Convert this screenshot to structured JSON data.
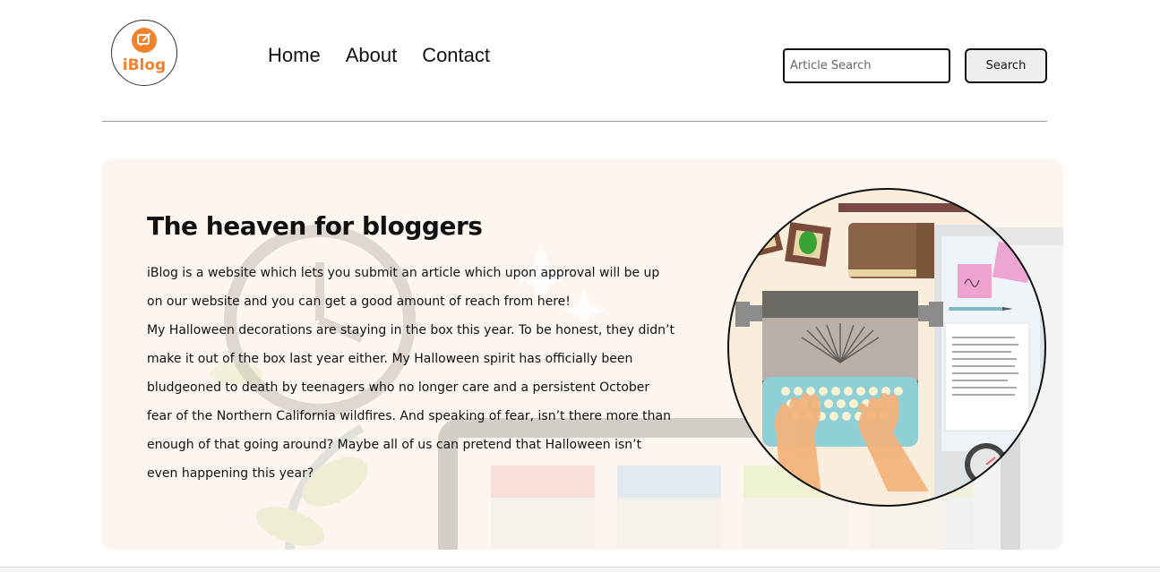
{
  "brand": {
    "name": "iBlog",
    "color": "#f0822e",
    "icon": "chat-edit-icon"
  },
  "nav": {
    "items": [
      {
        "label": "Home"
      },
      {
        "label": "About"
      },
      {
        "label": "Contact"
      }
    ]
  },
  "search": {
    "placeholder": "Article Search",
    "value": "",
    "button_label": "Search"
  },
  "hero": {
    "title": "The heaven for bloggers",
    "intro": "iBlog is a website which lets you submit an article which upon approval will be up on our website and you can get a good amount of reach from here!",
    "body": "My Halloween decorations are staying in the box this year. To be honest, they didn’t make it out of the box last year either. My Halloween spirit has officially been bludgeoned to death by teenagers who no longer care and a persistent October fear of the Northern California wildfires. And speaking of fear, isn’t there more than enough of that going around? Maybe all of us can pretend that Halloween isn’t even happening this year?",
    "background_color": "#fdf5ef",
    "illustration": "typewriter-desk-illustration"
  }
}
